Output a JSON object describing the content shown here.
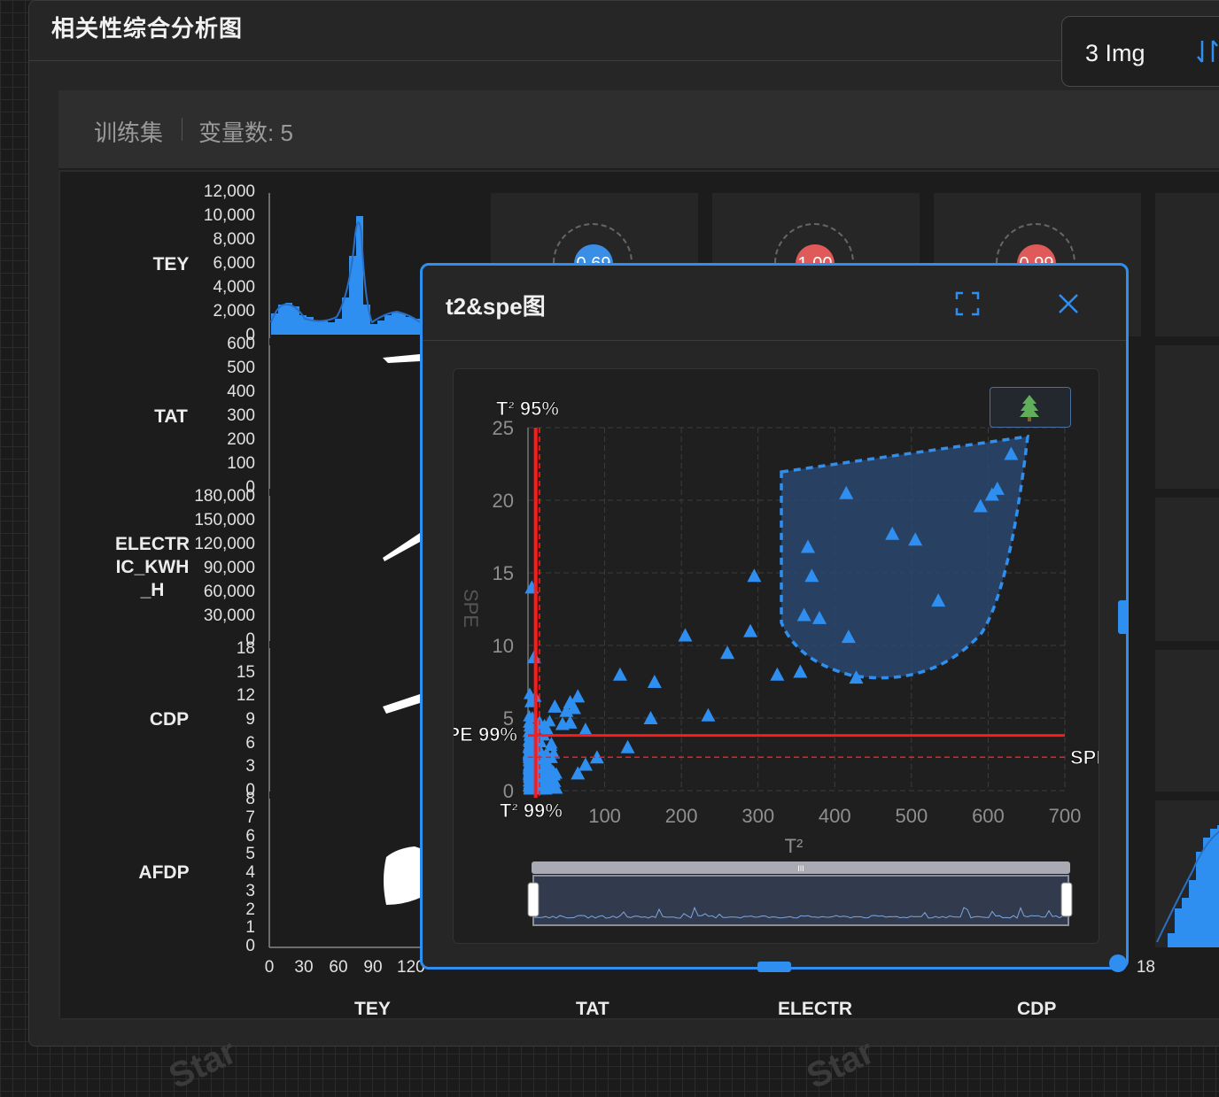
{
  "page": {
    "title": "相关性综合分析图",
    "image_count": "3 Img"
  },
  "info_bar": {
    "dataset": "训练集",
    "variables": "变量数: 5"
  },
  "matrix": {
    "rows": [
      {
        "label": "TEY",
        "ticks": [
          "12,000",
          "10,000",
          "8,000",
          "6,000",
          "4,000",
          "2,000",
          "0"
        ]
      },
      {
        "label": "TAT",
        "ticks": [
          "600",
          "500",
          "400",
          "300",
          "200",
          "100",
          "0"
        ]
      },
      {
        "label": "ELECTRIC_KWH_H",
        "label_lines": [
          "ELECTR",
          "IC_KWH",
          "_H"
        ],
        "ticks": [
          "180,000",
          "150,000",
          "120,000",
          "90,000",
          "60,000",
          "30,000",
          "0"
        ]
      },
      {
        "label": "CDP",
        "ticks": [
          "18",
          "15",
          "12",
          "9",
          "6",
          "3",
          "0"
        ]
      },
      {
        "label": "AFDP",
        "ticks": [
          "8",
          "7",
          "6",
          "5",
          "4",
          "3",
          "2",
          "1",
          "0"
        ]
      }
    ],
    "columns": [
      "TEY",
      "TAT",
      "ELECTR",
      "CDP"
    ],
    "x_ticks_first": [
      "0",
      "30",
      "60",
      "90",
      "120"
    ],
    "x_tick_last": "18",
    "correlations": [
      {
        "value": "0.69",
        "color": "#3a8ee6"
      },
      {
        "value": "1.00",
        "color": "#e05a5a"
      },
      {
        "value": "0.99",
        "color": "#e05a5a"
      }
    ]
  },
  "dialog": {
    "title": "t2&spe图",
    "fullscreen_icon": "fullscreen-icon",
    "close_icon": "close-icon",
    "tool_icon": "tree-icon",
    "labels": {
      "t2_95": "T² 95%",
      "t2_99": "T² 99%",
      "spe_99": "SPE 99%",
      "spe_right": "SPE",
      "y_axis": "SPE"
    },
    "colors": {
      "points": "#2f8ff0",
      "limit": "#ff1a1a",
      "region": "#2a4a73"
    },
    "chart_data": {
      "type": "scatter",
      "xlabel": "T²",
      "ylabel": "SPE",
      "xlim": [
        0,
        700
      ],
      "ylim": [
        0,
        25
      ],
      "x_ticks": [
        100,
        200,
        300,
        400,
        500,
        600,
        700
      ],
      "y_ticks": [
        0,
        5,
        10,
        15,
        20,
        25
      ],
      "grid": true,
      "thresholds": {
        "t2_95": 10,
        "t2_99": 15,
        "spe_95": 2.3,
        "spe_99": 3.8
      },
      "outliers": [
        [
          5,
          14
        ],
        [
          8,
          9.2
        ],
        [
          35,
          5.8
        ],
        [
          50,
          5.5
        ],
        [
          55,
          6.1
        ],
        [
          60,
          5.7
        ],
        [
          65,
          6.5
        ],
        [
          120,
          8
        ],
        [
          130,
          3
        ],
        [
          160,
          5
        ],
        [
          165,
          7.5
        ],
        [
          205,
          10.7
        ],
        [
          235,
          5.2
        ],
        [
          260,
          9.5
        ],
        [
          290,
          11
        ],
        [
          295,
          14.8
        ],
        [
          325,
          8
        ],
        [
          355,
          8.2
        ],
        [
          360,
          12.1
        ],
        [
          365,
          16.8
        ],
        [
          370,
          14.8
        ],
        [
          380,
          11.9
        ],
        [
          415,
          20.5
        ],
        [
          418,
          10.6
        ],
        [
          428,
          7.8
        ],
        [
          475,
          17.7
        ],
        [
          505,
          17.3
        ],
        [
          535,
          13.1
        ],
        [
          590,
          19.6
        ],
        [
          605,
          20.4
        ],
        [
          612,
          20.8
        ],
        [
          630,
          23.2
        ],
        [
          15,
          4.7
        ],
        [
          25,
          4.2
        ],
        [
          45,
          4.6
        ],
        [
          55,
          4.7
        ],
        [
          75,
          4.2
        ],
        [
          90,
          2.3
        ],
        [
          75,
          1.8
        ],
        [
          65,
          1.2
        ]
      ]
    },
    "slider": {
      "handle_label": "III"
    }
  },
  "watermark": "Star"
}
